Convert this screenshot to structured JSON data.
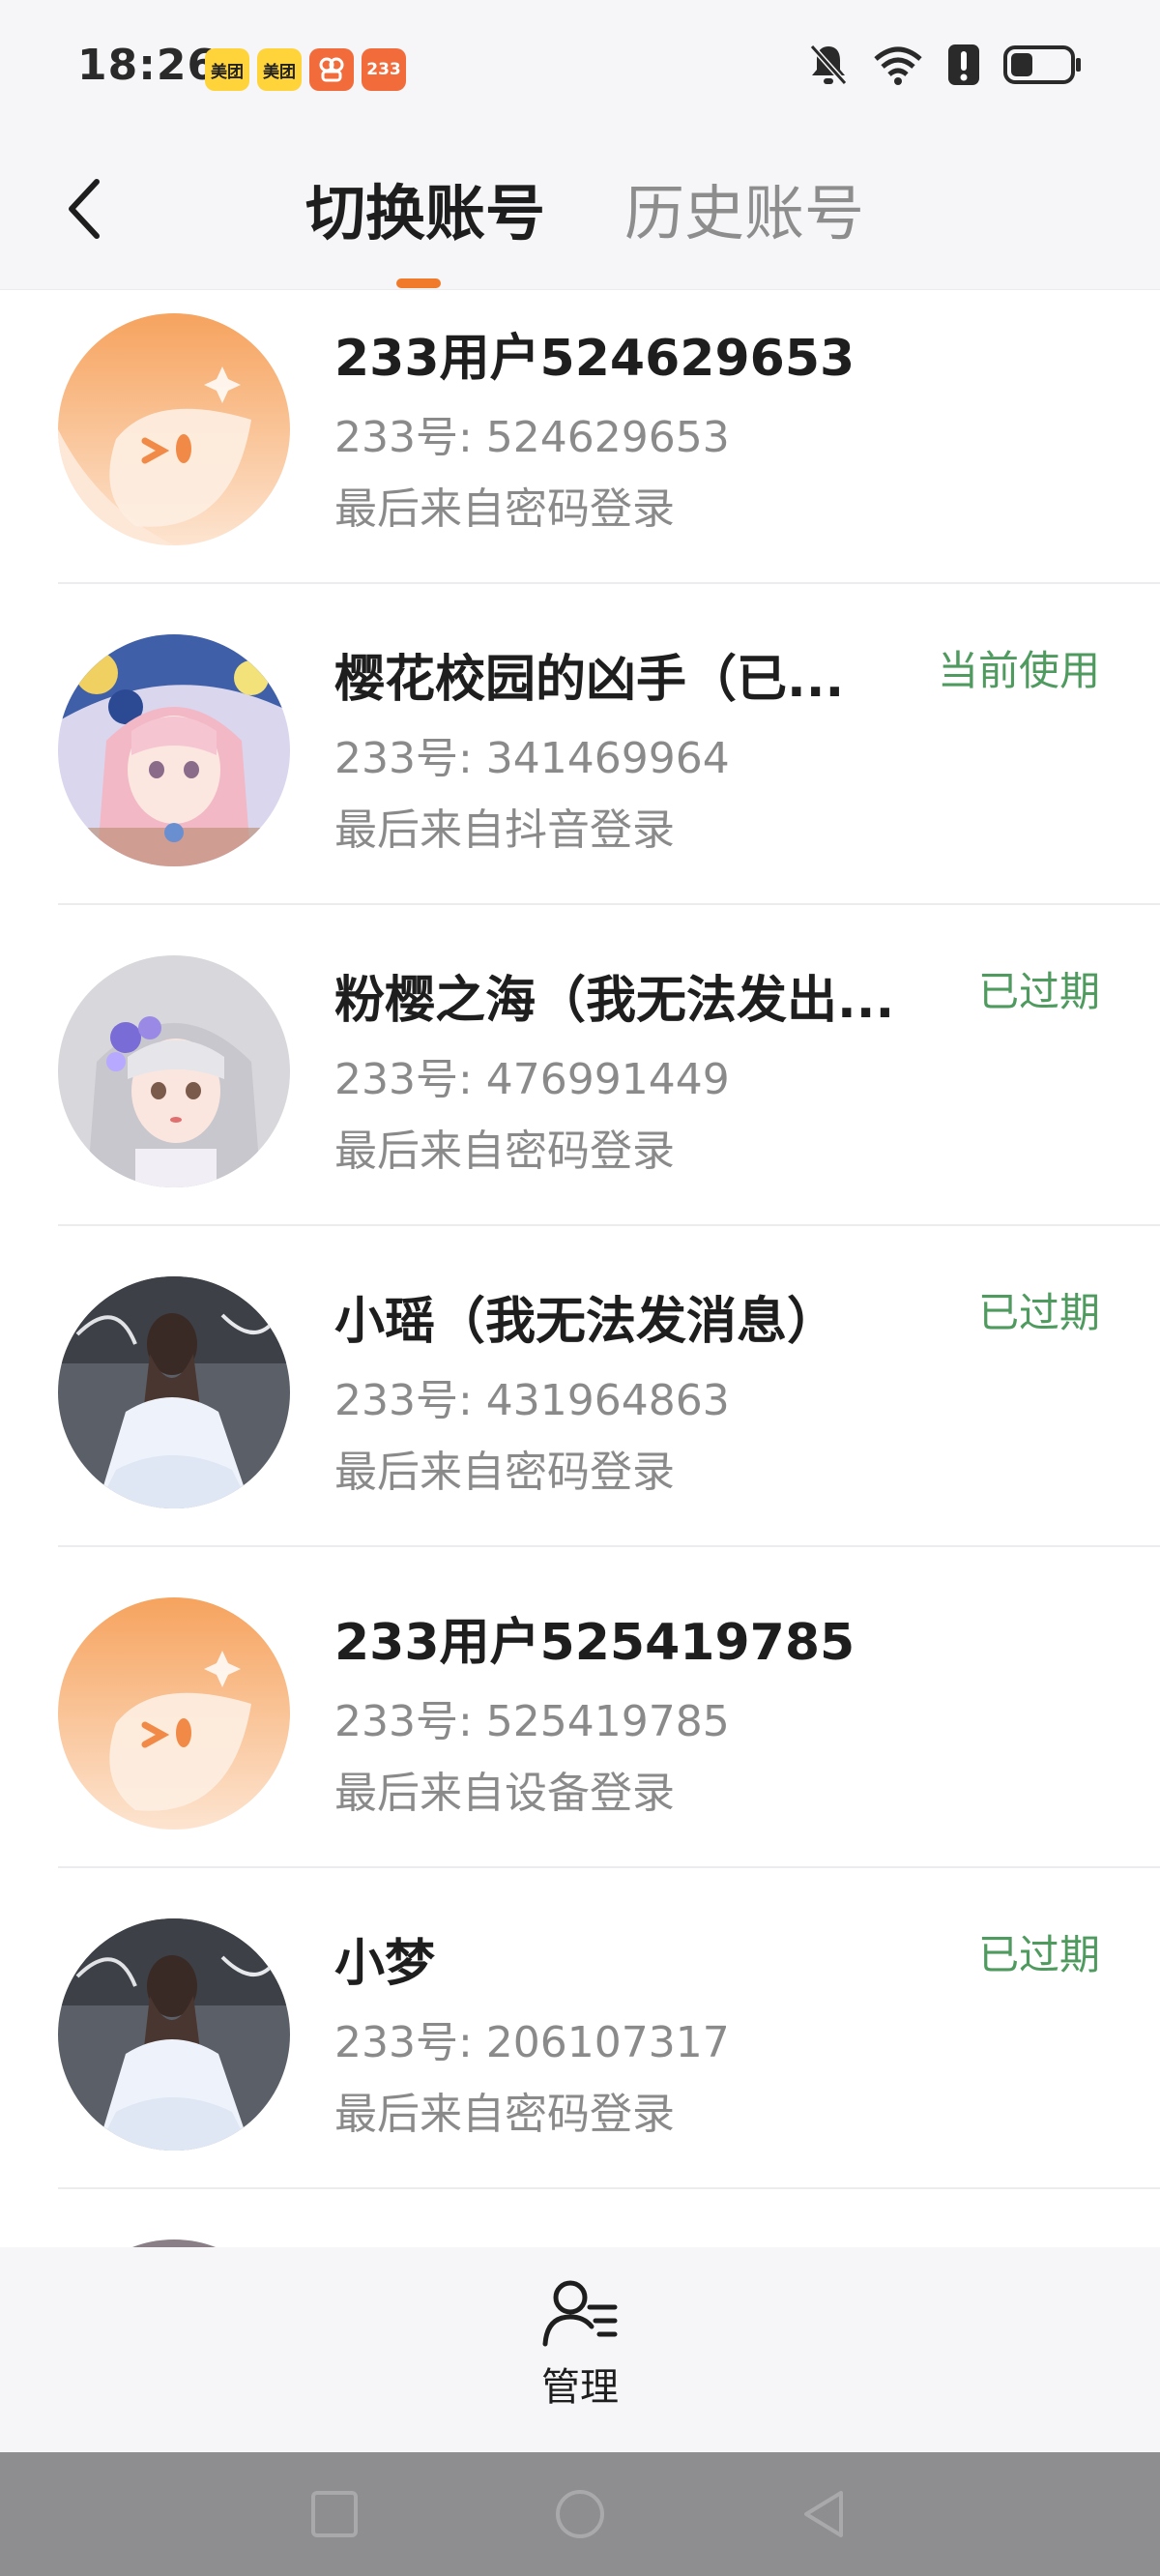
{
  "status_bar": {
    "time": "18:26",
    "app_icons": [
      {
        "name": "meituan-icon",
        "label": "美团"
      },
      {
        "name": "meituan-icon",
        "label": "美团"
      },
      {
        "name": "app-icon",
        "label": ""
      },
      {
        "name": "app-233-icon",
        "label": "233"
      }
    ],
    "right_icons": [
      "mute-icon",
      "wifi-icon",
      "alert-icon",
      "battery-icon"
    ]
  },
  "header": {
    "tabs": [
      {
        "label": "切换账号",
        "active": true
      },
      {
        "label": "历史账号",
        "active": false
      }
    ],
    "accent_color": "#f07a2a"
  },
  "accounts": [
    {
      "name": "233用户524629653",
      "id": "233号: 524629653",
      "source": "最后来自密码登录",
      "status": "",
      "avatar": "default-orange-avatar"
    },
    {
      "name": "樱花校园的凶手（已...",
      "id": "233号: 341469964",
      "source": "最后来自抖音登录",
      "status": "当前使用",
      "avatar": "anime-pink-hair-avatar"
    },
    {
      "name": "粉樱之海（我无法发出...",
      "id": "233号: 476991449",
      "source": "最后来自密码登录",
      "status": "已过期",
      "avatar": "anime-silver-hair-avatar"
    },
    {
      "name": "小瑶（我无法发消息）",
      "id": "233号: 431964863",
      "source": "最后来自密码登录",
      "status": "已过期",
      "avatar": "girl-white-dress-avatar"
    },
    {
      "name": "233用户525419785",
      "id": "233号: 525419785",
      "source": "最后来自设备登录",
      "status": "",
      "avatar": "default-orange-avatar"
    },
    {
      "name": "小梦",
      "id": "233号: 206107317",
      "source": "最后来自密码登录",
      "status": "已过期",
      "avatar": "girl-white-dress-avatar"
    }
  ],
  "status_color": "#4f9a5e",
  "manage": {
    "label": "管理",
    "icon": "user-list-icon"
  },
  "nav_bar": {
    "buttons": [
      "recents-button",
      "home-button",
      "back-button"
    ]
  }
}
